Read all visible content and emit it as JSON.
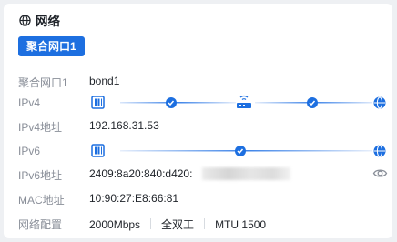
{
  "title": "网络",
  "tab": {
    "label": "聚合网口1"
  },
  "rows": {
    "agg": {
      "label": "聚合网口1",
      "value": "bond1"
    },
    "ipv4": {
      "label": "IPv4"
    },
    "ipv4_addr": {
      "label": "IPv4地址",
      "value": "192.168.31.53"
    },
    "ipv6": {
      "label": "IPv6"
    },
    "ipv6_addr": {
      "label": "IPv6地址",
      "value": "2409:8a20:840:d420:"
    },
    "mac": {
      "label": "MAC地址",
      "value": "10:90:27:E8:66:81"
    },
    "net_config": {
      "label": "网络配置",
      "speed": "2000Mbps",
      "duplex": "全双工",
      "mtu": "MTU 1500"
    }
  },
  "icons": {
    "title": "globe-icon",
    "nic": "network-card-icon",
    "check": "check-circle-icon",
    "router": "router-icon",
    "internet": "globe-filled-icon",
    "reveal": "eye-icon"
  },
  "colors": {
    "accent": "#1d6fe0",
    "line_start": "#ffffff",
    "line_end": "#1d6fe0"
  }
}
